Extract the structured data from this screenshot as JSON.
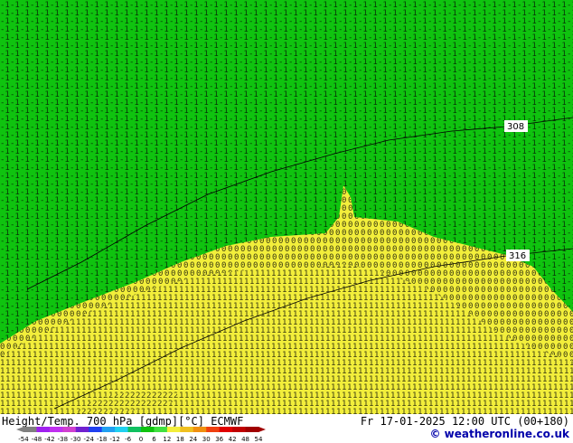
{
  "map": {
    "regions": [
      {
        "name": "cold-region",
        "color": "#0fc30f",
        "glyph": "-1",
        "temperature_c": -1
      },
      {
        "name": "zero-region",
        "color": "#f2ee3b",
        "glyph": "0",
        "temperature_c": 0
      },
      {
        "name": "warm-region",
        "color": "#f2ee3b",
        "glyph": "1",
        "temperature_c": 1
      },
      {
        "name": "warmer-region",
        "color": "#f2ee3b",
        "glyph": "2",
        "temperature_c": 2
      }
    ],
    "contours": [
      {
        "label": "308"
      },
      {
        "label": "316"
      }
    ]
  },
  "footer": {
    "title": "Height/Temp. 700 hPa [gdmp][°C] ECMWF",
    "date": "Fr 17-01-2025 12:00 UTC (00+180)",
    "credit": "© weatheronline.co.uk"
  },
  "colorbar": {
    "ticks": [
      "-54",
      "-48",
      "-42",
      "-38",
      "-30",
      "-24",
      "-18",
      "-12",
      "-6",
      "0",
      "6",
      "12",
      "18",
      "24",
      "30",
      "36",
      "42",
      "48",
      "54"
    ],
    "colors": [
      "#808080",
      "#a020f0",
      "#c030f0",
      "#d040d0",
      "#7020d0",
      "#2040f0",
      "#20a0f0",
      "#20d0f0",
      "#10c060",
      "#0fc30f",
      "#40e040",
      "#f2ee3b",
      "#f0c020",
      "#f09010",
      "#f04010",
      "#e00000",
      "#c00000",
      "#a00000"
    ]
  }
}
